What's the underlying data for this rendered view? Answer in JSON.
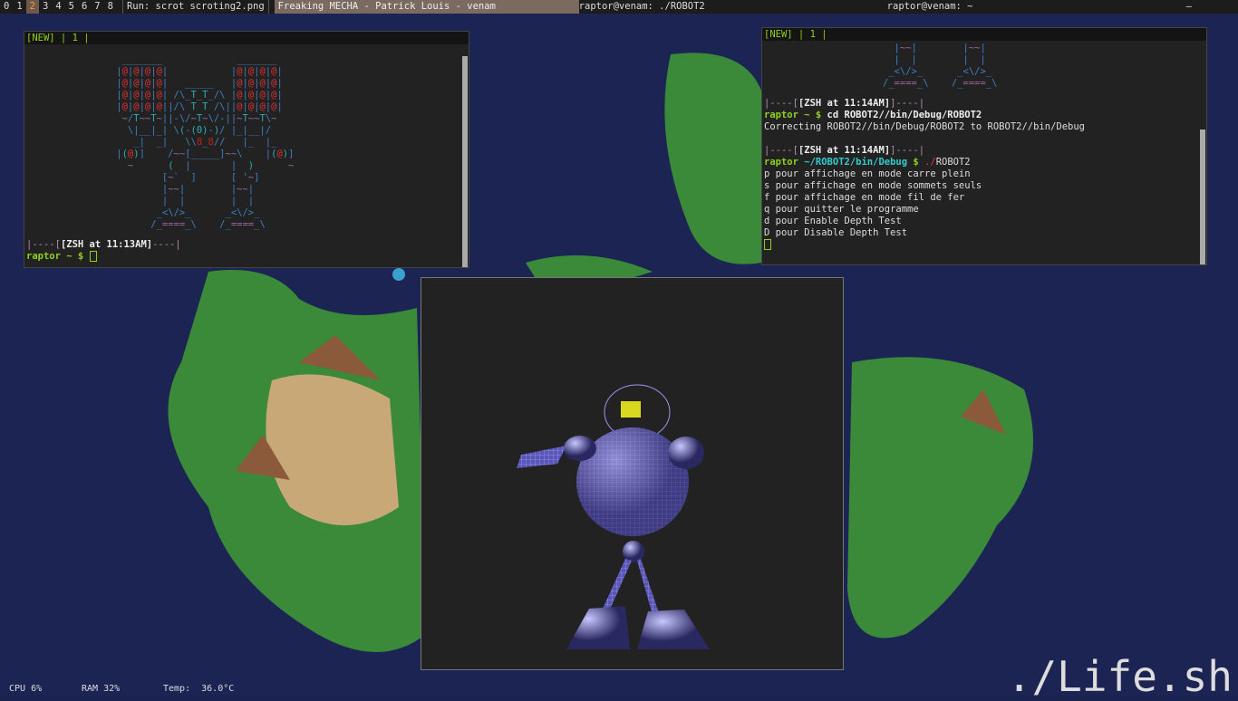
{
  "topbar": {
    "workspaces": [
      "0",
      "1",
      "2",
      "3",
      "4",
      "5",
      "6",
      "7",
      "8"
    ],
    "active_workspace": "2",
    "run_command": "Run: scrot scroting2.png",
    "now_playing": "Freaking MECHA - Patrick Louis - venam",
    "window1": "raptor@venam: ./ROBOT2",
    "window2": "raptor@venam: ~"
  },
  "left_terminal": {
    "tab_header": "[NEW] | 1 |",
    "art": [
      "                 _______             _______",
      "                |@|@|@|@|           |@|@|@|@|",
      "                |@|@|@|@|   _____   |@|@|@|@|",
      "                |@|@|@|@| /\\_T_T_/\\ |@|@|@|@|",
      "                |@|@|@|@||/\\ T T /\\||@|@|@|@|",
      "                 ~/T~~T~||-\\/~T~\\/-||~T~~T\\~",
      "                  \\|__|_| \\(-(0)-)/ |_|__|/",
      "                   _|  _|   \\\\8_8//   |_  |_",
      "                |(@)]    /~~[_____]~~\\    |(@)]",
      "                  ~      (  |       |  )      ~",
      "                        [~`  ]      [ '~]",
      "                        |~~|        |~~|",
      "                        |  |        |  |",
      "                       _<\\/>_      _<\\/>_",
      "                      /_====_\\    /_====_\\"
    ],
    "prompt_header": "[ZSH at 11:13AM]",
    "prompt": "raptor ~ $"
  },
  "right_terminal": {
    "tab_header": "[NEW] | 1 |",
    "art": [
      "                       |~~|        |~~|",
      "                       |  |        |  |",
      "                      _<\\/>_      _<\\/>_",
      "                     /_====_\\    /_====_\\"
    ],
    "block1_header": "[ZSH at 11:14AM]",
    "block1_prompt": "raptor ~ $",
    "block1_cmd": "cd ROBOT2//bin/Debug/ROBOT2",
    "block1_output": "Correcting ROBOT2//bin/Debug/ROBOT2 to ROBOT2//bin/Debug",
    "block2_header": "[ZSH at 11:14AM]",
    "block2_prompt_user": "raptor",
    "block2_prompt_path": "~/ROBOT2/bin/Debug",
    "block2_prompt_sign": "$",
    "block2_cmd_prefix": "./",
    "block2_cmd": "ROBOT2",
    "output_lines": [
      "p pour affichage en mode carre plein",
      "s pour affichage en mode sommets seuls",
      "f pour affichage en mode fil de fer",
      "q pour quitter le programme",
      "d pour Enable Depth Test",
      "D pour Disable Depth Test"
    ]
  },
  "statusbar": {
    "cpu": "CPU 6%",
    "ram": "RAM 32%",
    "temp": "Temp:  36.0°C"
  },
  "corner_label": "./Life.sh"
}
